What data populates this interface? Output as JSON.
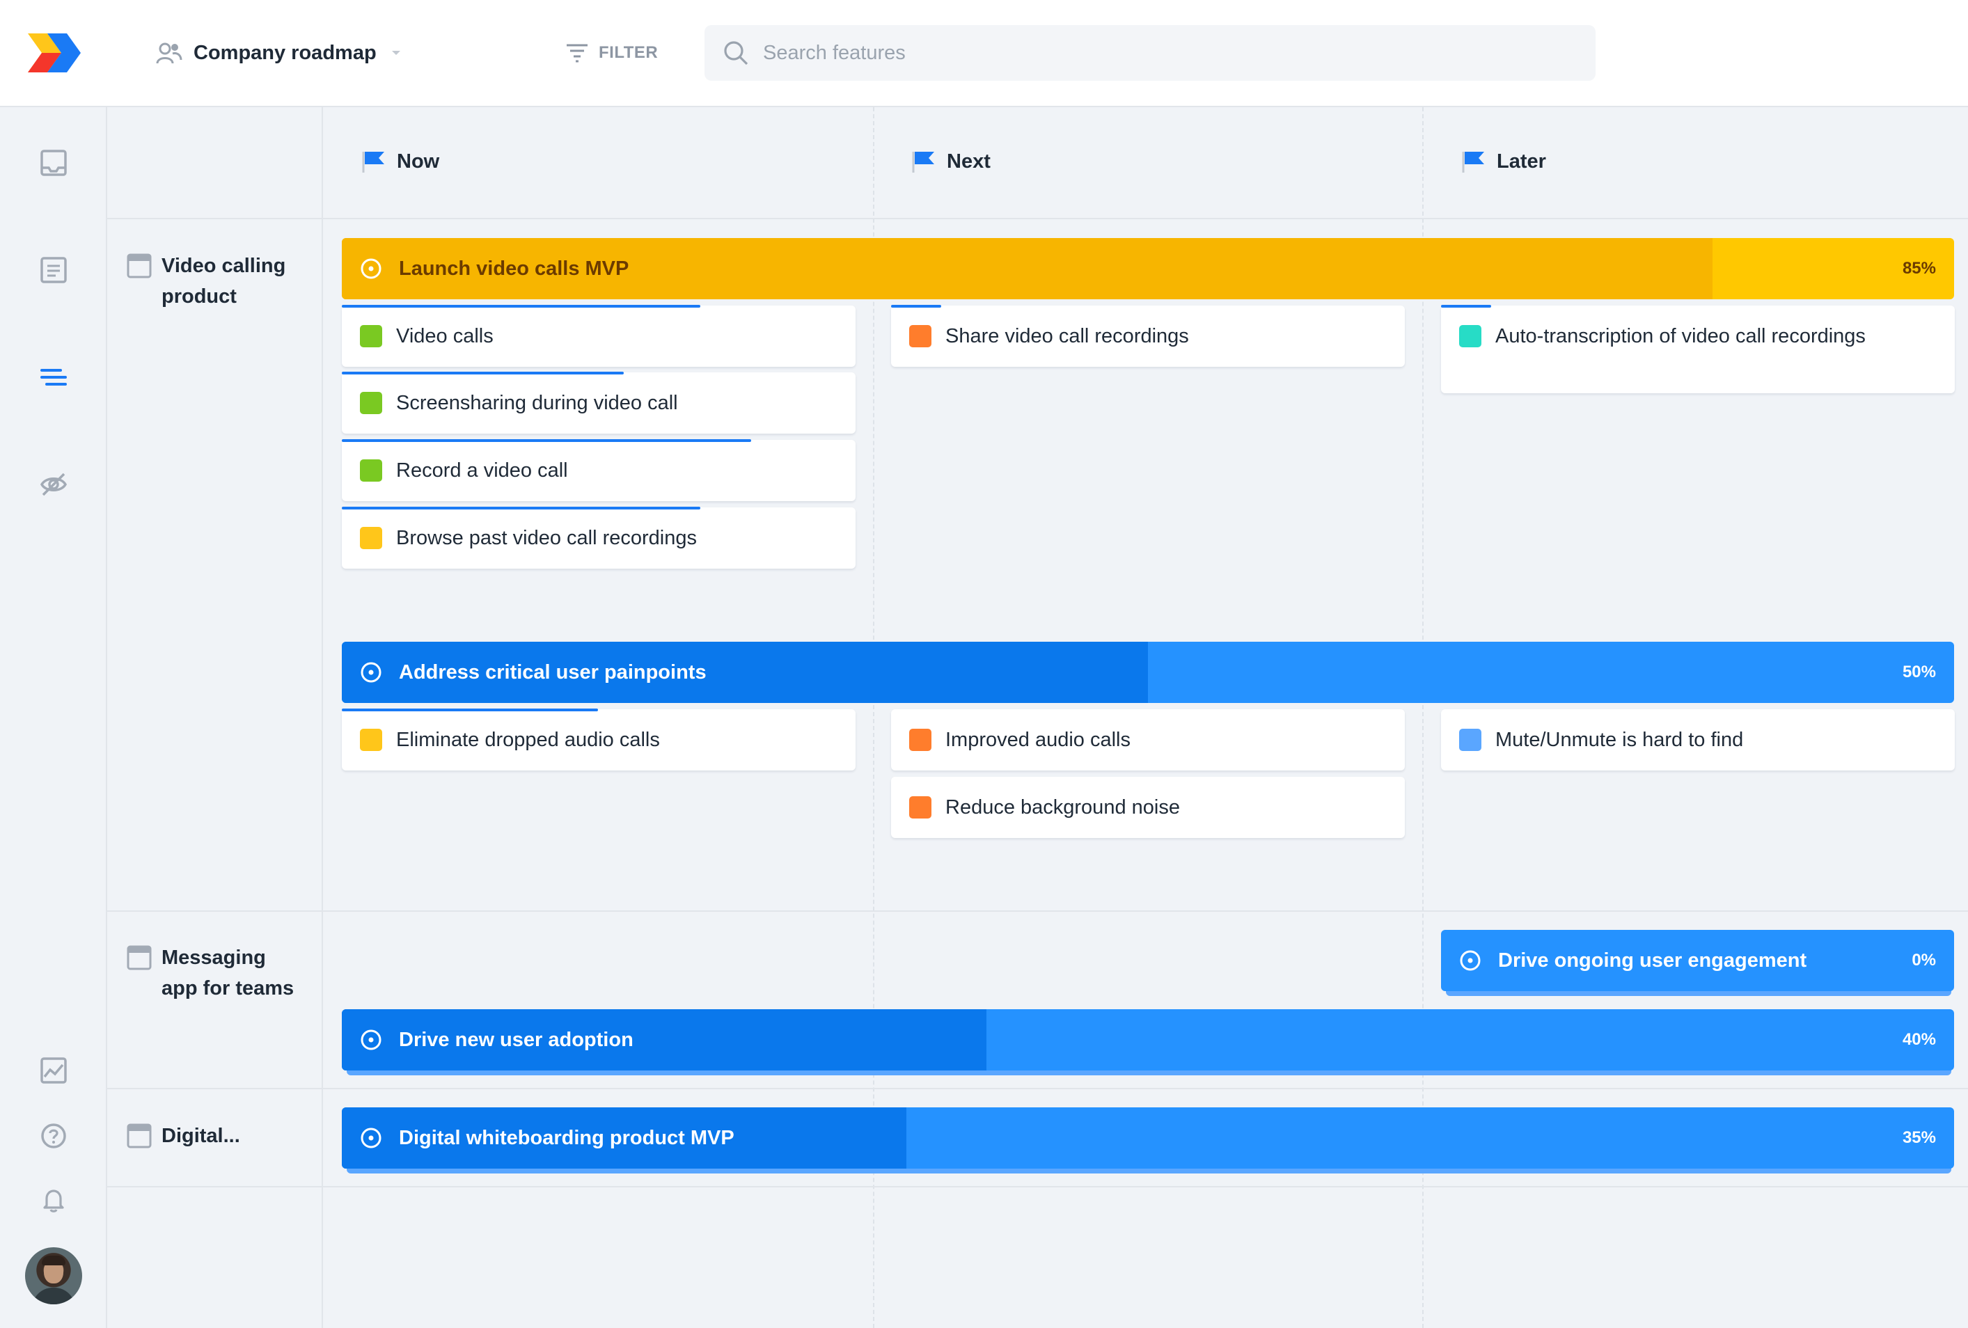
{
  "topbar": {
    "roadmap_title": "Company roadmap",
    "filter_label": "FILTER",
    "search_placeholder": "Search features"
  },
  "sidebar": {
    "items": [
      "inbox-icon",
      "notes-icon",
      "roadmap-icon",
      "hidden-icon",
      "insights-icon",
      "help-icon",
      "bell-icon",
      "avatar"
    ],
    "active_item": "roadmap-icon"
  },
  "columns": [
    {
      "label": "Now"
    },
    {
      "label": "Next"
    },
    {
      "label": "Later"
    }
  ],
  "products": [
    {
      "name_line1": "Video calling",
      "name_line2": "product"
    },
    {
      "name_line1": "Messaging",
      "name_line2": "app for teams"
    },
    {
      "name_line1": "Digital..."
    }
  ],
  "initiatives": {
    "launch_video": {
      "title": "Launch video calls MVP",
      "percent": "85%",
      "progress": 0.85
    },
    "address_painpoints": {
      "title": "Address critical user painpoints",
      "percent": "50%",
      "progress": 0.5
    },
    "drive_engagement": {
      "title": "Drive ongoing user engagement",
      "percent": "0%",
      "progress": 0.0
    },
    "drive_adoption": {
      "title": "Drive new user adoption",
      "percent": "40%",
      "progress": 0.4
    },
    "whiteboarding_mvp": {
      "title": "Digital whiteboarding product MVP",
      "percent": "35%",
      "progress": 0.35
    }
  },
  "features": {
    "video_calls": {
      "label": "Video calls",
      "status_color": "#7ac922"
    },
    "screensharing": {
      "label": "Screensharing during video call",
      "status_color": "#7ac922"
    },
    "record_call": {
      "label": "Record a video call",
      "status_color": "#7ac922"
    },
    "browse_recordings": {
      "label": "Browse past video call recordings",
      "status_color": "#ffc61a"
    },
    "share_recordings": {
      "label": "Share video call recordings",
      "status_color": "#ff7d2c"
    },
    "auto_transcription": {
      "label": "Auto-transcription of video call recordings",
      "status_color": "#27dcc6"
    },
    "eliminate_dropped": {
      "label": "Eliminate dropped audio calls",
      "status_color": "#ffc61a"
    },
    "improved_audio": {
      "label": "Improved audio calls",
      "status_color": "#ff7d2c"
    },
    "reduce_noise": {
      "label": "Reduce background noise",
      "status_color": "#ff7d2c"
    },
    "mute_unmute": {
      "label": "Mute/Unmute is hard to find",
      "status_color": "#5aa6ff"
    }
  },
  "colors": {
    "accent_blue": "#1a7af5",
    "initiative_blue_fill": "#0a78ec",
    "initiative_blue_rest": "#2592ff",
    "initiative_orange_fill": "#f7b500",
    "initiative_orange_rest": "#ffc800",
    "background": "#f0f3f7"
  }
}
